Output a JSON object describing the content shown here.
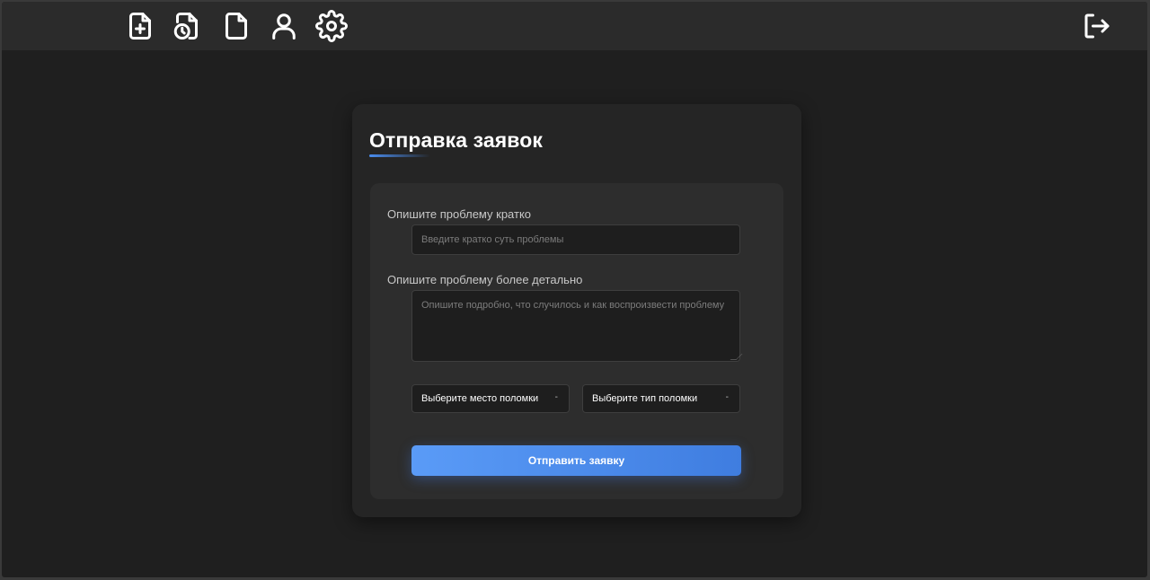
{
  "nav": {
    "icons": [
      "file-plus-icon",
      "file-history-icon",
      "file-icon",
      "user-icon",
      "gear-icon"
    ],
    "logout_icon": "logout-icon"
  },
  "form": {
    "title": "Отправка заявок",
    "short": {
      "label": "Опишите проблему кратко",
      "placeholder": "Введите кратко суть проблемы",
      "value": ""
    },
    "detail": {
      "label": "Опишите проблему более детально",
      "placeholder": "Опишите подробно, что случилось и как воспроизвести проблему",
      "value": ""
    },
    "place_select": {
      "selected": "Выберите место поломки",
      "caret": "-"
    },
    "type_select": {
      "selected": "Выберите тип поломки",
      "caret": "-"
    },
    "submit_label": "Отправить заявку"
  },
  "colors": {
    "background": "#1f1f1f",
    "topbar": "#2b2b2b",
    "card": "#252525",
    "accent": "#4a8df0"
  }
}
